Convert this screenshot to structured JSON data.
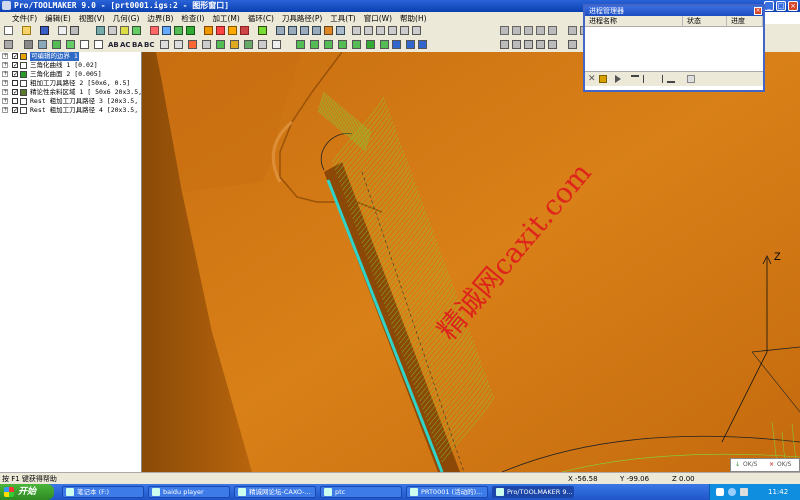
{
  "window": {
    "title": "Pro/TOOLMAKER 9.0 - [prt0001.igs:2 - 图形窗口]"
  },
  "menu": [
    "文件(F)",
    "编辑(E)",
    "视图(V)",
    "几何(G)",
    "边界(B)",
    "检查(I)",
    "加工(M)",
    "循环(C)",
    "刀具路径(P)",
    "工具(T)",
    "窗口(W)",
    "帮助(H)"
  ],
  "toolbar2_text": [
    "AB",
    "AC",
    "BA",
    "BC"
  ],
  "tree": [
    {
      "label": "可编辑的边界 1",
      "checked": true,
      "selected": true,
      "icon": "boundary-icon"
    },
    {
      "label": "三角化曲线 1 [0.02]",
      "checked": true,
      "selected": false,
      "icon": "curve-icon"
    },
    {
      "label": "三角化曲面 2 [0.005]",
      "checked": true,
      "selected": false,
      "icon": "surface-icon"
    },
    {
      "label": "粗加工刀具路径 2 [50x6, 0.5]",
      "checked": false,
      "selected": false,
      "icon": "toolpath-icon"
    },
    {
      "label": "精论性余料区域 1 [ 50x6 20x3.5,",
      "checked": true,
      "selected": false,
      "icon": "region-icon"
    },
    {
      "label": "Rest 粗加工刀具路径 3 [20x3.5, C",
      "checked": false,
      "selected": false,
      "icon": "toolpath-icon"
    },
    {
      "label": "Rest 粗加工刀具路径 4 [20x3.5, C",
      "checked": true,
      "selected": false,
      "icon": "toolpath-icon"
    }
  ],
  "viewport": {
    "axis_label": "Z",
    "watermark": "精诚网caxit.com",
    "colors": {
      "surface": "#d97a12",
      "surface_dark": "#b4600a",
      "toolpath": "#7fd83a",
      "toolpath_cyan": "#2fd3c8"
    }
  },
  "process_manager": {
    "title": "进程管理器",
    "columns": [
      "进程名称",
      "状态",
      "进度"
    ]
  },
  "status": {
    "help": "按 F1 键获得帮助",
    "x": "X -56.58",
    "y": "Y -99.06",
    "z": "Z 0.00",
    "ok_left": "OK/S",
    "ok_right": "OK/S"
  },
  "taskbar": {
    "start": "开始",
    "tasks": [
      {
        "label": "笔记本 (F:)",
        "active": false
      },
      {
        "label": "baidu player",
        "active": false
      },
      {
        "label": "精诚网论坛-CAXO-...",
        "active": false
      },
      {
        "label": "ptc",
        "active": false
      },
      {
        "label": "PRT0001 (活动的)...",
        "active": false
      },
      {
        "label": "Pro/TOOLMAKER 9...",
        "active": true
      }
    ],
    "time": "11:42"
  }
}
